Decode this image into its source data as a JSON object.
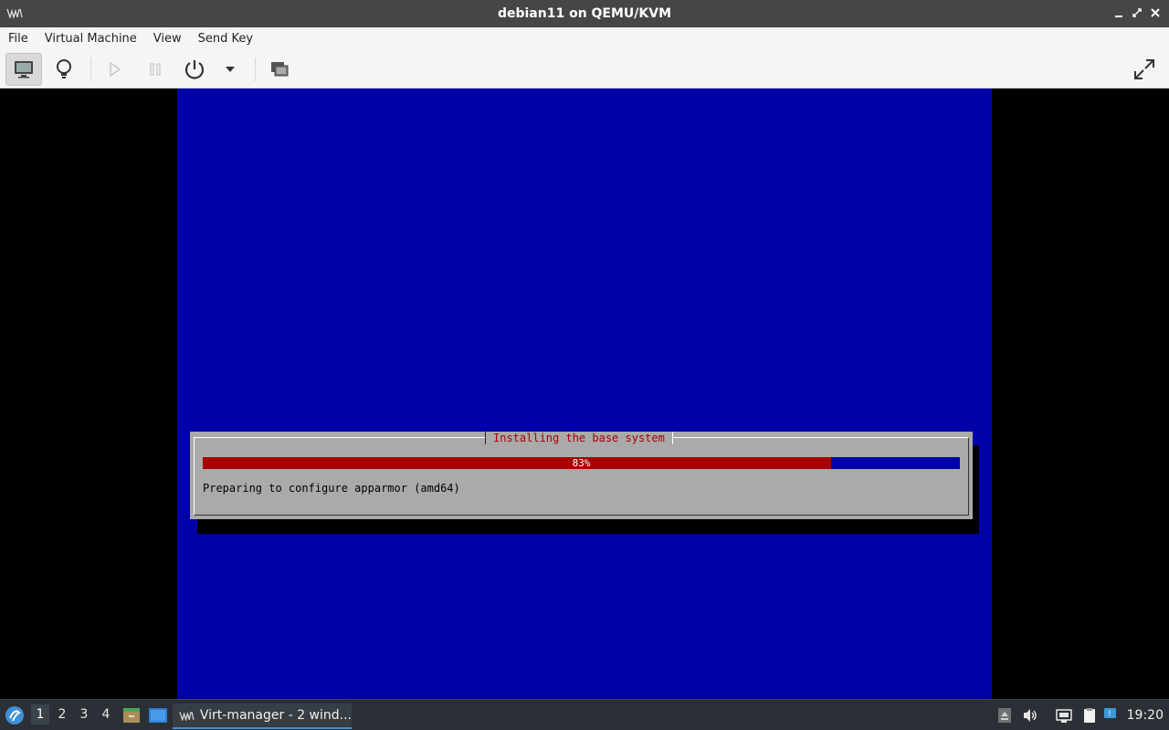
{
  "window": {
    "title": "debian11 on QEMU/KVM",
    "icons": [
      "virt-manager-logo-icon",
      "minimize-icon",
      "restore-icon",
      "close-icon"
    ]
  },
  "menubar": {
    "items": [
      "File",
      "Virtual Machine",
      "View",
      "Send Key"
    ]
  },
  "toolbar": {
    "buttons": [
      "console-icon",
      "details-lightbulb-icon",
      "run-icon",
      "pause-icon",
      "power-icon",
      "chevron-down-icon",
      "snapshots-icon",
      "fullscreen-icon"
    ]
  },
  "installer": {
    "dialog_title": "Installing the base system",
    "progress_percent": 83,
    "progress_label": "83%",
    "status_text": "Preparing to configure apparmor (amd64)",
    "colors": {
      "background": "#0101a8",
      "dialog": "#aaaaaa",
      "bar_fill": "#a80000",
      "title": "#a80000"
    }
  },
  "taskbar": {
    "workspaces": [
      "1",
      "2",
      "3",
      "4"
    ],
    "active_workspace": "1",
    "task_label": "Virt-manager - 2 wind...",
    "clock": "19:20",
    "tray_icons": [
      "eject-icon",
      "volume-icon",
      "network-icon",
      "clipboard-icon",
      "update-notifier-icon"
    ]
  }
}
